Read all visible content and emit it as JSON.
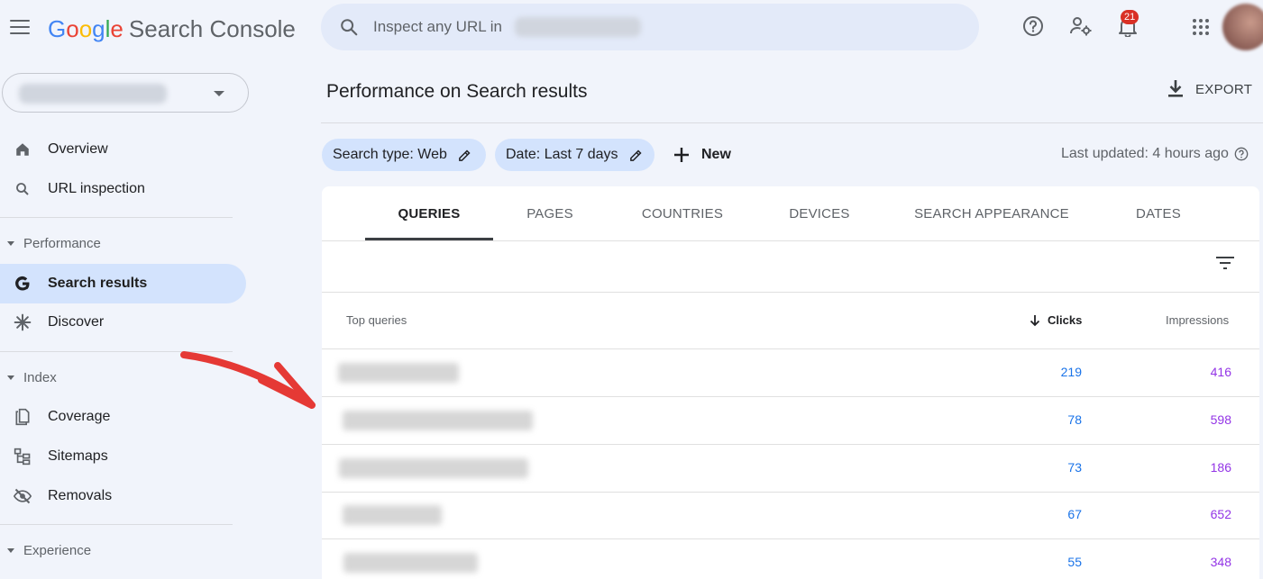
{
  "header": {
    "logo_google": [
      "G",
      "o",
      "o",
      "g",
      "l",
      "e"
    ],
    "product_name": "Search Console",
    "search_placeholder": "Inspect any URL in",
    "notification_count": "21",
    "icons": [
      "menu-icon",
      "help-icon",
      "manage-users-icon",
      "notifications-icon",
      "apps-icon",
      "avatar"
    ]
  },
  "sidebar": {
    "nav_top": [
      {
        "label": "Overview",
        "icon": "home-icon"
      },
      {
        "label": "URL inspection",
        "icon": "search-icon"
      }
    ],
    "sections": [
      {
        "label": "Performance",
        "items": [
          {
            "label": "Search results",
            "icon": "google-g-icon",
            "active": true
          },
          {
            "label": "Discover",
            "icon": "asterisk-icon"
          }
        ]
      },
      {
        "label": "Index",
        "items": [
          {
            "label": "Coverage",
            "icon": "copy-icon"
          },
          {
            "label": "Sitemaps",
            "icon": "sitemap-icon"
          },
          {
            "label": "Removals",
            "icon": "visibility-off-icon"
          }
        ]
      },
      {
        "label": "Experience",
        "items": []
      }
    ]
  },
  "main": {
    "title": "Performance on Search results",
    "export_label": "EXPORT",
    "filters": [
      {
        "label": "Search type: Web"
      },
      {
        "label": "Date: Last 7 days"
      }
    ],
    "new_label": "New",
    "last_updated": "Last updated: 4 hours ago",
    "tabs": [
      "QUERIES",
      "PAGES",
      "COUNTRIES",
      "DEVICES",
      "SEARCH APPEARANCE",
      "DATES"
    ],
    "active_tab": "QUERIES",
    "table": {
      "headers": {
        "query": "Top queries",
        "clicks": "Clicks",
        "impressions": "Impressions"
      },
      "rows": [
        {
          "clicks": "219",
          "impressions": "416"
        },
        {
          "clicks": "78",
          "impressions": "598"
        },
        {
          "clicks": "73",
          "impressions": "186"
        },
        {
          "clicks": "67",
          "impressions": "652"
        },
        {
          "clicks": "55",
          "impressions": "348"
        }
      ]
    }
  },
  "colors": {
    "accent_blue": "#1a73e8",
    "impressions_purple": "#9334e6",
    "active_nav": "#d3e3fd",
    "annotation_arrow": "#e53935"
  }
}
